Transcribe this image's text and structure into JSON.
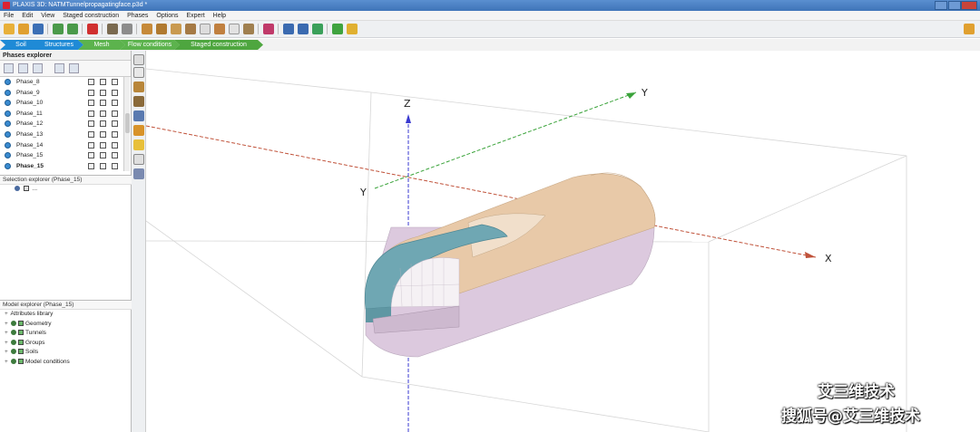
{
  "window": {
    "title": "PLAXIS 3D: NATMTunnelpropagatingface.p3d *"
  },
  "menu": [
    "File",
    "Edit",
    "View",
    "Staged construction",
    "Phases",
    "Options",
    "Expert",
    "Help"
  ],
  "mode_tabs": [
    {
      "label": "Soil",
      "color": "#1f8ad6"
    },
    {
      "label": "Structures",
      "color": "#1f8ad6"
    },
    {
      "label": "Mesh",
      "color": "#5cb34d"
    },
    {
      "label": "Flow conditions",
      "color": "#5cb34d"
    },
    {
      "label": "Staged construction",
      "color": "#4ea63f"
    }
  ],
  "phases_explorer": {
    "title": "Phases explorer",
    "phases": [
      "Phase_8",
      "Phase_9",
      "Phase_10",
      "Phase_11",
      "Phase_12",
      "Phase_13",
      "Phase_14",
      "Phase_15",
      "Phase_15"
    ],
    "selected_index": 8
  },
  "selection_explorer": {
    "title": "Selection explorer (Phase_15)",
    "item": "..."
  },
  "model_explorer": {
    "title": "Model explorer (Phase_15)",
    "items": [
      "Attributes library",
      "Geometry",
      "Tunnels",
      "Groups",
      "Soils",
      "Model conditions"
    ]
  },
  "viewport": {
    "axes": {
      "x": "X",
      "y": "Y",
      "y2": "Y",
      "z": "Z"
    },
    "colors": {
      "x_axis": "#c0523a",
      "y_axis": "#3aa33a",
      "z_axis": "#3a3ad0",
      "shell": "#e6c6a6",
      "lining": "#6fa7b3",
      "lower": "#d9c7db",
      "box": "#d0d0d0"
    }
  },
  "watermark": {
    "line1": "艾三维技术",
    "line2": "搜狐号@艾三维技术"
  }
}
